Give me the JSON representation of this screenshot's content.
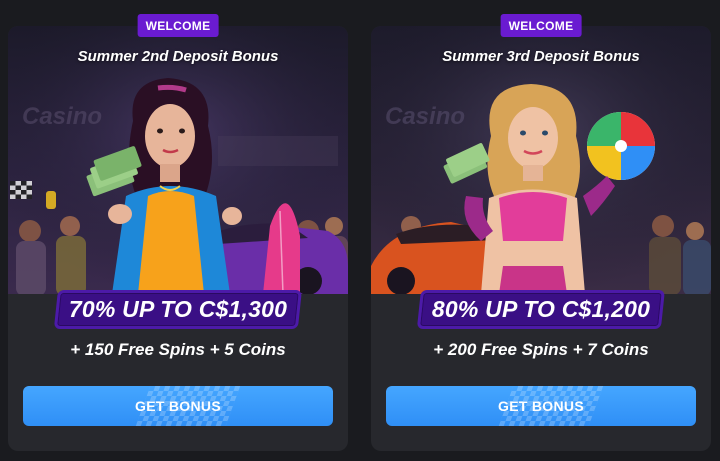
{
  "cards": [
    {
      "badge": "WELCOME",
      "title": "Summer 2nd Deposit Bonus",
      "offer": "70% UP TO C$1,300",
      "extra": "+ 150 Free Spins + 5 Coins",
      "button": "GET BONUS",
      "theme": {
        "top": "#2a1f3d",
        "floor": "#3b2a4e",
        "accent": "#e63a8a",
        "car": "#6a2ea8",
        "figure_hair": "#2a0f24",
        "figure_outfit": "#f7a21b"
      }
    },
    {
      "badge": "WELCOME",
      "title": "Summer 3rd Deposit Bonus",
      "offer": "80% UP TO C$1,200",
      "extra": "+ 200 Free Spins + 7 Coins",
      "button": "GET BONUS",
      "theme": {
        "top": "#25203a",
        "floor": "#3a2c45",
        "accent": "#f05a9a",
        "car": "#d9531f",
        "figure_hair": "#d8a457",
        "figure_outfit": "#e23d9a"
      }
    }
  ],
  "colors": {
    "background": "#1a1b1f",
    "card": "#27282d",
    "badge": "#6a1bd1",
    "offer_bg": "#3a0f85",
    "button": "#3a9bff"
  }
}
